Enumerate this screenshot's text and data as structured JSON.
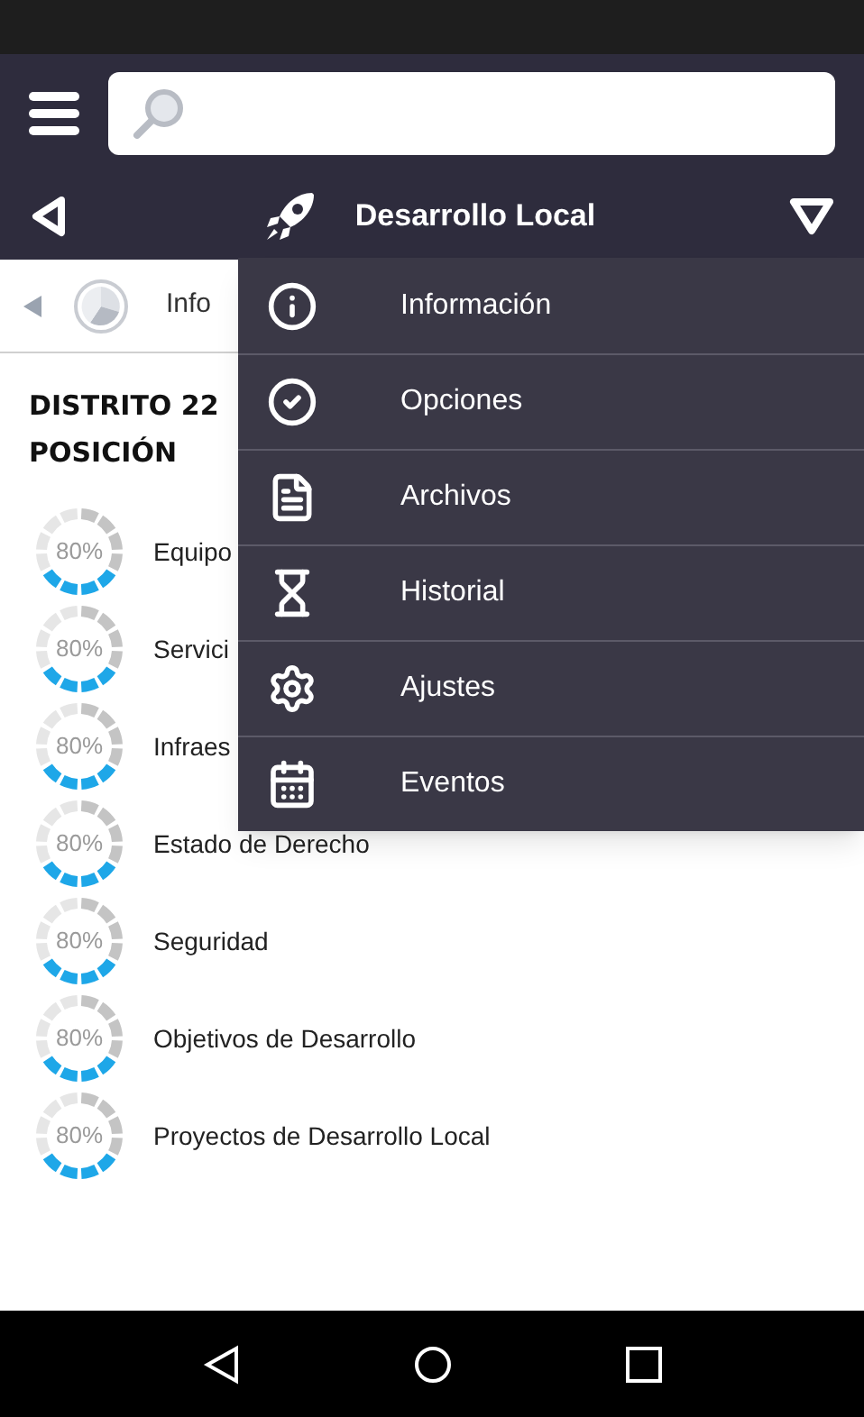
{
  "nav": {
    "title": "Desarrollo Local"
  },
  "subbar": {
    "label": "Info"
  },
  "district": {
    "title": "DISTRITO 22",
    "subtitle": "POSICIÓN"
  },
  "items": [
    {
      "label": "Equipo",
      "percent": "80%"
    },
    {
      "label": "Servici",
      "percent": "80%"
    },
    {
      "label": "Infraes",
      "percent": "80%"
    },
    {
      "label": "Estado de Derecho",
      "percent": "80%"
    },
    {
      "label": "Seguridad",
      "percent": "80%"
    },
    {
      "label": "Objetivos de Desarrollo",
      "percent": "80%"
    },
    {
      "label": "Proyectos de Desarrollo Local",
      "percent": "80%"
    }
  ],
  "menu": [
    {
      "kind": "info",
      "label": "Información"
    },
    {
      "kind": "check",
      "label": "Opciones"
    },
    {
      "kind": "file",
      "label": "Archivos"
    },
    {
      "kind": "hourglass",
      "label": "Historial"
    },
    {
      "kind": "gear",
      "label": "Ajustes"
    },
    {
      "kind": "calendar",
      "label": "Eventos"
    }
  ]
}
